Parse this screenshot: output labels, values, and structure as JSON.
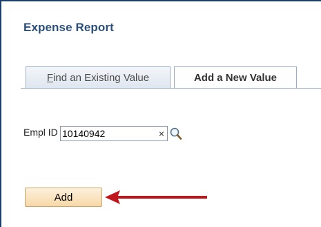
{
  "page": {
    "title": "Expense Report"
  },
  "tabs": [
    {
      "label_prefix": "F",
      "label_rest": "ind an Existing Value",
      "active": false
    },
    {
      "label": "Add a New Value",
      "active": true
    }
  ],
  "form": {
    "empl_id_label": "Empl ID",
    "empl_id_value": "10140942",
    "clear_glyph": "×"
  },
  "actions": {
    "add_label": "Add"
  },
  "icons": {
    "clear": "close-icon",
    "lookup": "search-icon",
    "pointer": "arrow-icon"
  },
  "colors": {
    "title": "#2c4f79",
    "frame": "#1b3f6b",
    "button_fill": "#f7d9a8",
    "arrow": "#c0161b"
  }
}
